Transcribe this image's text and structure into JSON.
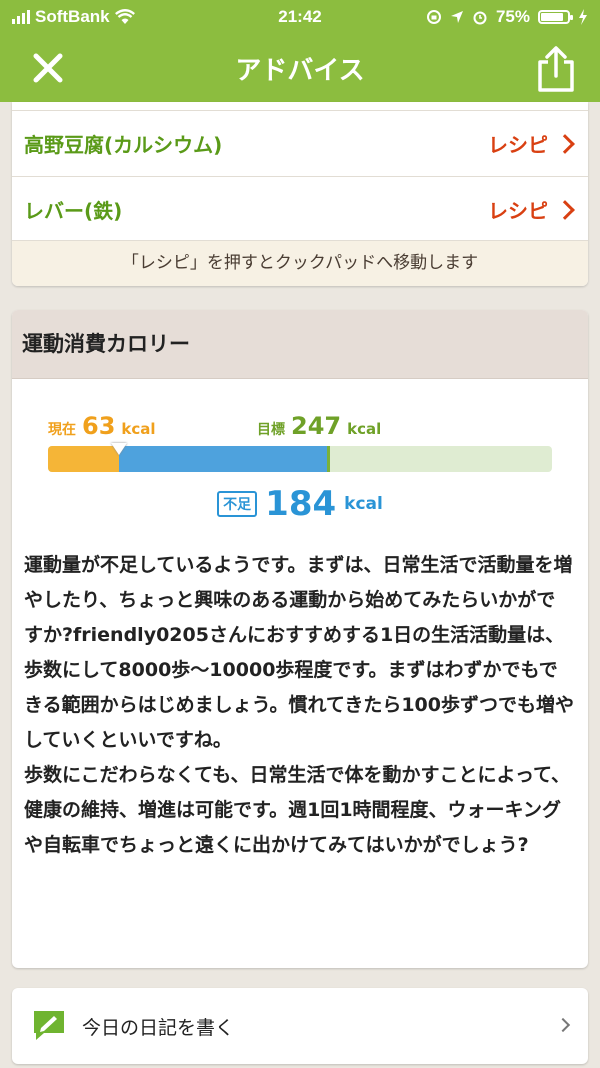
{
  "status_bar": {
    "carrier": "SoftBank",
    "time": "21:42",
    "battery": "75%"
  },
  "nav": {
    "title": "アドバイス",
    "close_icon": "close-icon",
    "share_icon": "share-icon"
  },
  "colors": {
    "brand_green": "#8cbd3f",
    "food_green": "#5a9a18",
    "link_red": "#d94012",
    "current_orange": "#f5b537",
    "shortage_blue": "#2a94d6"
  },
  "recipes": [
    {
      "food": "高野豆腐(カルシウム)",
      "link": "レシピ"
    },
    {
      "food": "レバー(鉄)",
      "link": "レシピ"
    }
  ],
  "recipe_note": "「レシピ」を押すとクックパッドへ移動します",
  "exercise": {
    "heading": "運動消費カロリー",
    "current_label": "現在",
    "current_value": "63",
    "target_label": "目標",
    "target_value": "247",
    "unit": "kcal",
    "shortage_tag": "不足",
    "shortage_value": "184",
    "progress_current_fraction": 0.14,
    "progress_target_fraction": 0.56,
    "advice": [
      "運動量が不足しているようです。まずは、日常生活で活動量を増やしたり、ちょっと興味のある運動から始めてみたらいかがですか?friendly0205さんにおすすめする1日の生活活動量は、歩数にして8000歩〜10000歩程度です。まずはわずかでもできる範囲からはじめましょう。慣れてきたら100歩ずつでも増やしていくといいですね。",
      "歩数にこだわらなくても、日常生活で体を動かすことによって、健康の維持、増進は可能です。週1回1時間程度、ウォーキングや自転車でちょっと遠くに出かけてみてはいかがでしょう?"
    ]
  },
  "diary": {
    "label": "今日の日記を書く",
    "icon": "pencil-note-icon"
  }
}
